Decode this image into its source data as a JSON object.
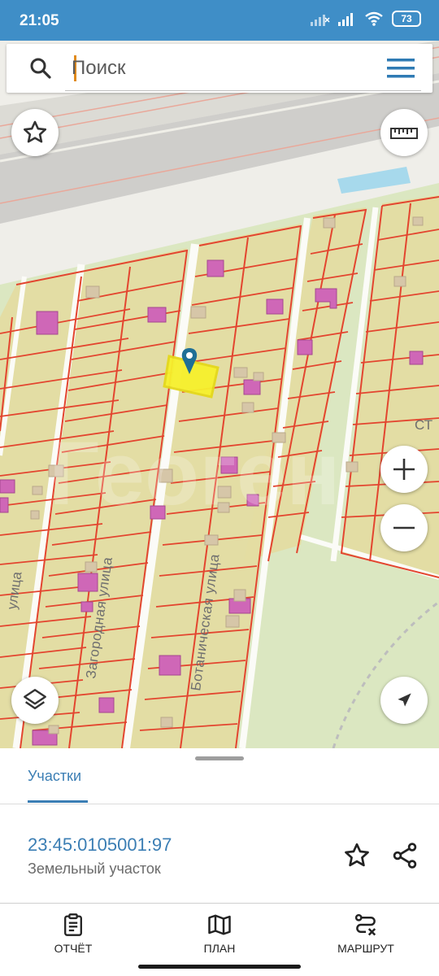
{
  "status_bar": {
    "time": "21:05",
    "battery": "73"
  },
  "search": {
    "placeholder": "Поиск"
  },
  "map": {
    "street_labels": [
      "Загородная улица",
      "Ботаническая улица",
      "улица",
      "СТ"
    ],
    "watermark": "Геоген",
    "parcel_line_color": "#e3452f",
    "parcel_fill_color": "#e4dca2",
    "building_color": "#cf67b7",
    "selected_color": "#f6f02c",
    "pin_color": "#1f6f96"
  },
  "sheet": {
    "tab_label": "Участки",
    "parcel_number": "23:45:0105001:97",
    "parcel_type": "Земельный участок"
  },
  "bottom_nav": [
    {
      "label": "ОТЧЁТ",
      "icon": "clipboard-icon"
    },
    {
      "label": "ПЛАН",
      "icon": "map-icon"
    },
    {
      "label": "МАРШРУТ",
      "icon": "route-icon"
    }
  ]
}
